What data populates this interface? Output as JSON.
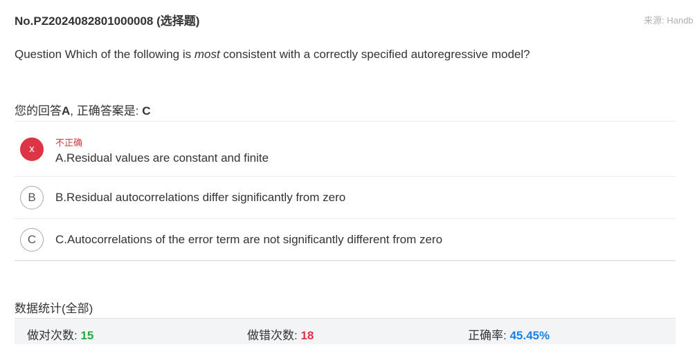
{
  "header": {
    "question_id": "No.PZ2024082801000008 (选择题)",
    "source": "来源: Handb"
  },
  "question": {
    "prefix": "Question Which of the following is ",
    "emphasis": "most",
    "suffix": " consistent with a correctly specified autoregressive model?"
  },
  "answer": {
    "label": "您的回答",
    "your_answer": "A",
    "separator": ", 正确答案是: ",
    "correct_answer": "C"
  },
  "options": [
    {
      "badge": "x",
      "status": "不正确",
      "text": "A.Residual values are constant and finite"
    },
    {
      "badge": "B",
      "text": "B.Residual autocorrelations differ significantly from zero"
    },
    {
      "badge": "C",
      "text": "C.Autocorrelations of the error term are not significantly different from zero"
    }
  ],
  "stats": {
    "title": "数据统计(全部)",
    "correct_label": "做对次数: ",
    "correct_value": "15",
    "wrong_label": "做错次数: ",
    "wrong_value": "18",
    "rate_label": "正确率: ",
    "rate_value": "45.45%"
  },
  "colors": {
    "incorrect": "#dc3545",
    "correct_count": "#28a745",
    "rate": "#1a82e2"
  }
}
